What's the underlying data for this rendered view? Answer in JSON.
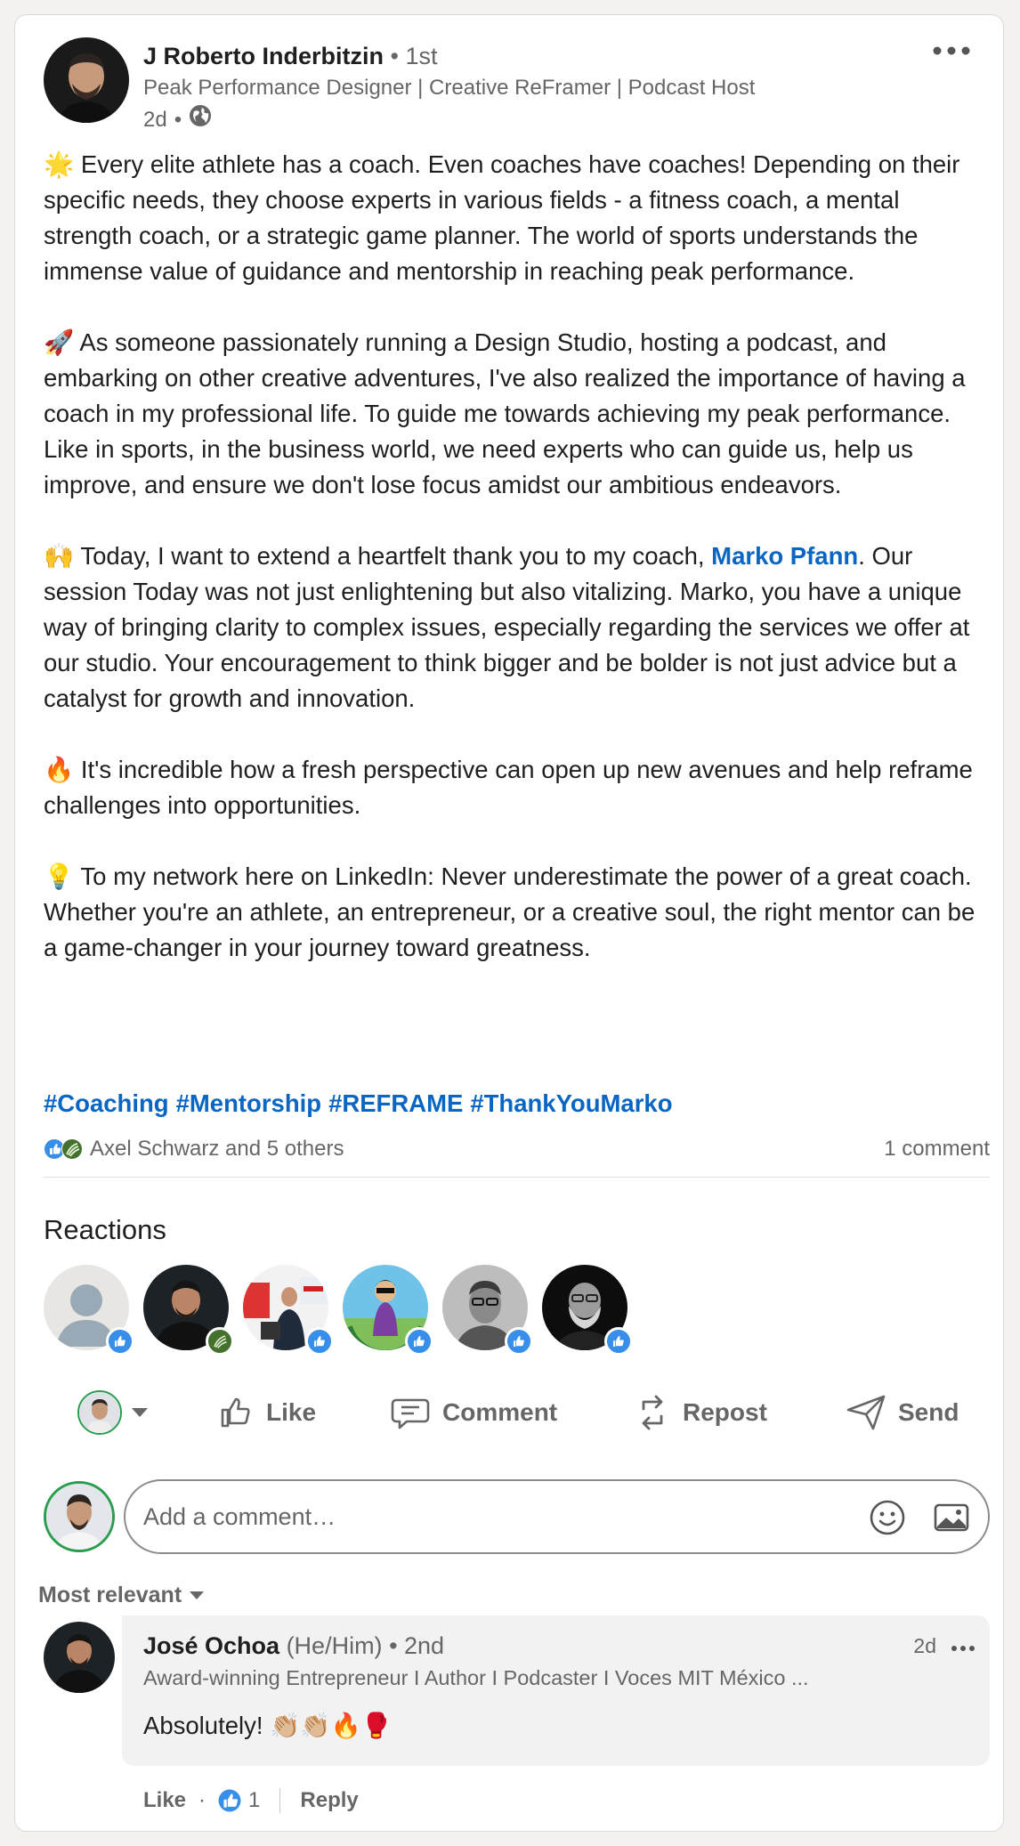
{
  "author": {
    "name": "J Roberto Inderbitzin",
    "degree": " • 1st",
    "headline": "Peak Performance Designer | Creative ReFramer | Podcast Host",
    "time": "2d",
    "bullet": "•",
    "visibility_icon": "globe-icon"
  },
  "post": {
    "p1": "🌟 Every elite athlete has a coach. Even coaches have coaches! Depending on their specific needs, they choose experts in various fields - a fitness coach, a mental strength coach, or a strategic game planner. The world of sports understands the immense value of guidance and mentorship in reaching peak performance.",
    "p2": "🚀 As someone passionately running a Design Studio, hosting a podcast, and embarking on other creative adventures, I've also realized the importance of having a coach in my professional life. To guide me towards achieving my peak performance. Like in sports, in the business world, we need experts who can guide us, help us improve, and ensure we don't lose focus amidst our ambitious endeavors.",
    "p3_before": "🙌 Today, I want to extend a heartfelt thank you to my coach, ",
    "p3_mention": "Marko Pfann",
    "p3_after": ". Our session Today was not just enlightening but also vitalizing. Marko, you have a unique way of bringing clarity to complex issues, especially regarding the services we offer at our studio. Your encouragement to think bigger and be bolder is not just advice but a catalyst for growth and innovation.",
    "p4": "🔥 It's incredible how a fresh perspective can open up new avenues and help reframe challenges into opportunities.",
    "p5": "💡 To my network here on LinkedIn: Never underestimate the power of a great coach. Whether you're an athlete, an entrepreneur, or a creative soul, the right mentor can be a game-changer in your journey toward greatness.",
    "hashtags": [
      "#Coaching",
      "#Mentorship",
      "#REFRAME",
      "#ThankYouMarko"
    ]
  },
  "social": {
    "reactions_text": "Axel Schwarz and 5 others",
    "comments_text": "1 comment"
  },
  "reactions": {
    "heading": "Reactions"
  },
  "actions": {
    "like": "Like",
    "comment": "Comment",
    "repost": "Repost",
    "send": "Send"
  },
  "comment_box": {
    "placeholder": "Add a comment…"
  },
  "sort": {
    "label": "Most relevant"
  },
  "comment": {
    "name": "José Ochoa",
    "pronouns": " (He/Him)",
    "degree": " • 2nd",
    "headline": "Award-winning Entrepreneur I Author I Podcaster I Voces MIT México ...",
    "time": "2d",
    "text": "Absolutely! 👏🏼👏🏼🔥🥊",
    "like_label": "Like",
    "dot": "·",
    "like_count": "1",
    "reply_label": "Reply"
  },
  "colors": {
    "link": "#0a66c2",
    "secondary_text": "#666666",
    "like_badge": "#378fe9",
    "celebrate_badge": "#44712e"
  }
}
